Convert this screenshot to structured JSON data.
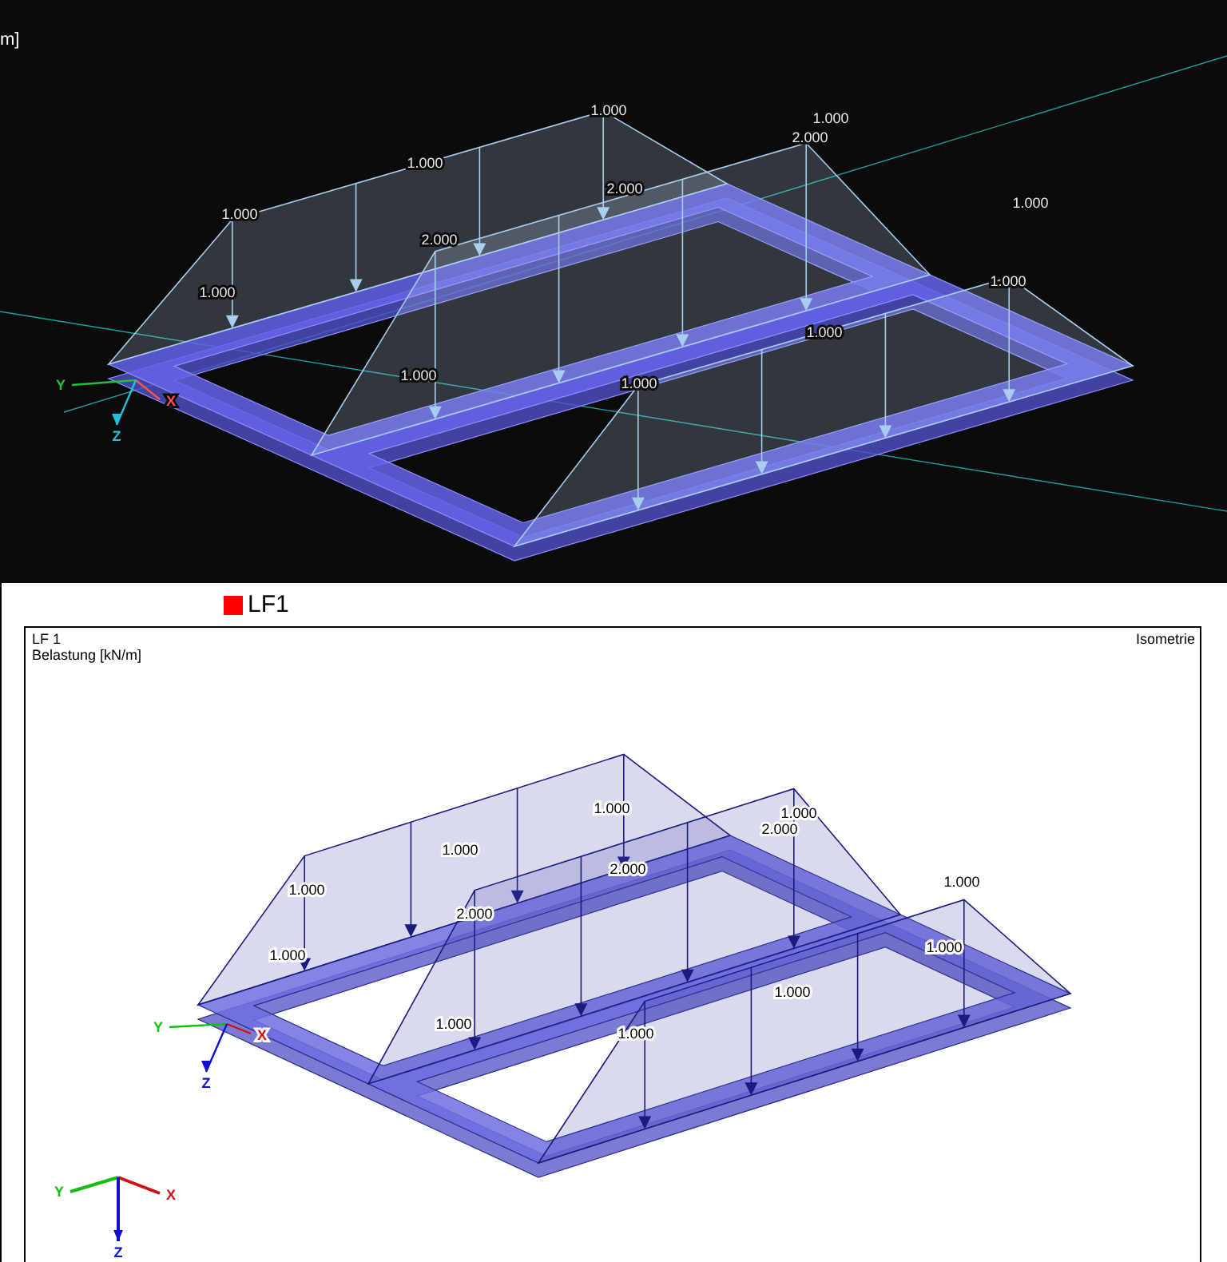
{
  "top_view": {
    "unit_label": "m]",
    "load_values": [
      "1.000",
      "1.000",
      "2.000",
      "1.000",
      "2.000",
      "1.000",
      "2.000",
      "1.000",
      "1.000",
      "1.000",
      "1.000",
      "1.000",
      "1.000"
    ],
    "axes": [
      "Y",
      "X",
      "Z"
    ]
  },
  "legend": [
    {
      "label": "LF1",
      "color": "#ff0000"
    }
  ],
  "panel": {
    "title": "LF 1",
    "subtitle": "Belastung [kN/m]",
    "view_name": "Isometrie",
    "load_values": [
      "1.000",
      "1.000",
      "2.000",
      "1.000",
      "2.000",
      "1.000",
      "2.000",
      "1.000",
      "1.000",
      "1.000",
      "1.000",
      "1.000",
      "1.000"
    ],
    "model_axes": [
      "Y",
      "X",
      "Z"
    ],
    "corner_axes": [
      "Y",
      "X",
      "Z"
    ]
  }
}
